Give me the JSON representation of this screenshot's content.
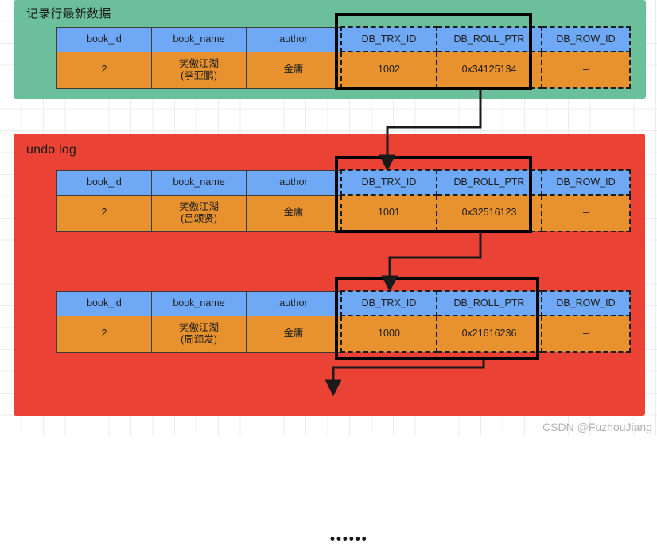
{
  "colors": {
    "panel_latest_bg": "#6cbf9b",
    "panel_undo_bg": "#ea4335",
    "table_header_bg": "#6fa8f5",
    "table_body_bg": "#e8912f",
    "outline": "#3b3b3b",
    "focus_box": "#000000",
    "connector": "#1a1a1a",
    "grid_line": "#ececec",
    "watermark": "#b3b3b3"
  },
  "panels": {
    "latest": {
      "title": "记录行最新数据"
    },
    "undo": {
      "title": "undo log"
    }
  },
  "columns": [
    "book_id",
    "book_name",
    "author",
    "DB_TRX_ID",
    "DB_ROLL_PTR",
    "DB_ROW_ID"
  ],
  "tables": [
    {
      "id": "latest-record-row",
      "book_id": "2",
      "book_name": "笑傲江湖\n(李亚鹏)",
      "author": "金庸",
      "db_trx_id": "1002",
      "db_roll_ptr": "0x34125134",
      "db_row_id": "–"
    },
    {
      "id": "undo-log-row-1",
      "book_id": "2",
      "book_name": "笑傲江湖\n(吕颂贤)",
      "author": "金庸",
      "db_trx_id": "1001",
      "db_roll_ptr": "0x32516123",
      "db_row_id": "–"
    },
    {
      "id": "undo-log-row-2",
      "book_id": "2",
      "book_name": "笑傲江湖\n(周润发)",
      "author": "金庸",
      "db_trx_id": "1000",
      "db_roll_ptr": "0x21616236",
      "db_row_id": "–"
    }
  ],
  "ellipsis": "••••••",
  "watermark": "CSDN @FuzhouJiang"
}
